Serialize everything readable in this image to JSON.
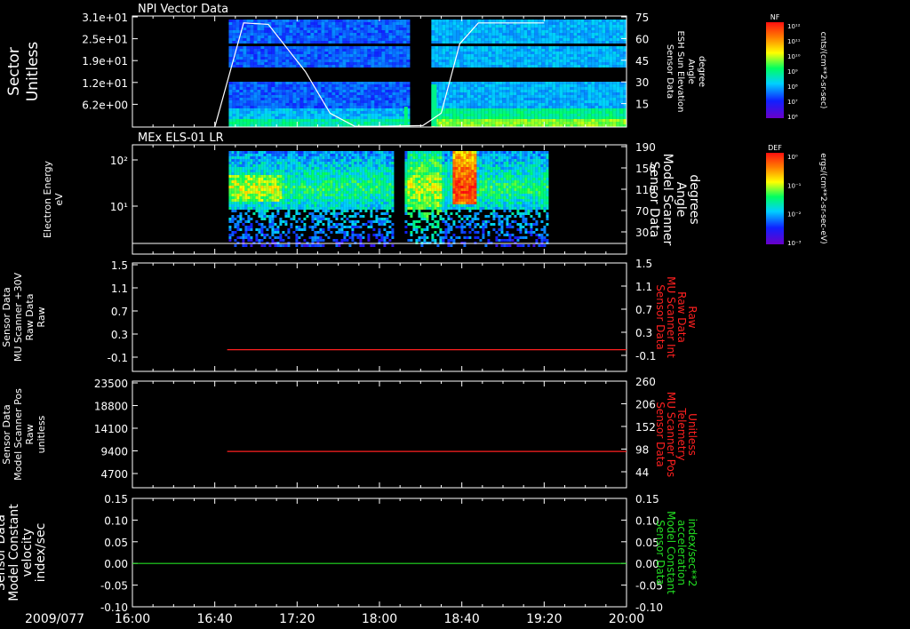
{
  "chart_data": {
    "date": "2009/077",
    "time_ticks": [
      "16:00",
      "16:40",
      "17:20",
      "18:00",
      "18:40",
      "19:20",
      "20:00"
    ],
    "panels": [
      {
        "type": "heatmap",
        "title": "NPI Vector Data",
        "ylabel": [
          "Sector",
          "Unitless"
        ],
        "yticks": [
          "3.1e+01",
          "2.5e+01",
          "1.9e+01",
          "1.2e+01",
          "6.2e+00"
        ],
        "right_ticks": [
          "75",
          "60",
          "45",
          "30",
          "15"
        ],
        "right_label": [
          "Sensor Data",
          "ESH Sun Elevation",
          "Angle",
          "degree"
        ],
        "right_label_color": "#ffffff",
        "overlay_line": {
          "name": "ESH Sun Elevation Angle",
          "points": [
            [
              16.667,
              0
            ],
            [
              16.9,
              75
            ],
            [
              17.1,
              74
            ],
            [
              17.4,
              40
            ],
            [
              17.6,
              10
            ],
            [
              17.8,
              0.5
            ],
            [
              18.0,
              0.5
            ],
            [
              18.35,
              1
            ],
            [
              18.5,
              10
            ],
            [
              18.65,
              60
            ],
            [
              18.8,
              75
            ],
            [
              19.333,
              75
            ]
          ],
          "color": "#ffffff"
        },
        "colorbar": {
          "label": "NF",
          "unit": "cnts/(cm**2-sr-sec)",
          "ticks": [
            "10¹²",
            "10¹¹",
            "10¹⁰",
            "10⁹",
            "10⁸",
            "10⁷",
            "10⁶"
          ]
        }
      },
      {
        "type": "heatmap",
        "title": "MEx ELS-01 LR",
        "ylabel": [
          "Electron Energy",
          "eV"
        ],
        "yticks": [
          "10²",
          "10¹"
        ],
        "right_ticks": [
          "190",
          "150",
          "110",
          "70",
          "30"
        ],
        "right_label": [
          "Sensor Data",
          "Model Scanner",
          "Angle",
          "degrees"
        ],
        "right_label_color": "#ffffff",
        "colorbar": {
          "label": "DEF",
          "unit": "ergs/(cm**2-sr-sec-eV)",
          "ticks": [
            "10⁰",
            "10⁻¹",
            "10⁻²",
            "10⁻³"
          ]
        }
      },
      {
        "type": "line",
        "ylabel": [
          "Sensor Data",
          "MU Scanner +30V",
          "Raw Data",
          "Raw"
        ],
        "yticks": [
          "1.5",
          "1.1",
          "0.7",
          "0.3",
          "-0.1"
        ],
        "right_ticks": [
          "1.5",
          "1.1",
          "0.7",
          "0.3",
          "-0.1"
        ],
        "right_label": [
          "Sensor Data",
          "MU Scanner Int",
          "Raw Data",
          "Raw"
        ],
        "right_label_color": "#ff2020",
        "ylim": [
          -0.5,
          1.5
        ],
        "series": [
          {
            "color": "#ff2020",
            "points": [
              [
                16.767,
                -0.1
              ],
              [
                20.0,
                -0.1
              ]
            ]
          }
        ]
      },
      {
        "type": "line",
        "ylabel": [
          "Sensor Data",
          "Model Scanner Pos",
          "Raw",
          "unitless"
        ],
        "yticks": [
          "23500",
          "18800",
          "14100",
          "9400",
          "4700"
        ],
        "right_ticks": [
          "260",
          "206",
          "152",
          "98",
          "44"
        ],
        "right_label": [
          "Sensor Data",
          "MU Scanner Pos",
          "Telemetry",
          "Unitless"
        ],
        "right_label_color": "#ff2020",
        "ylim": [
          0,
          23500
        ],
        "series": [
          {
            "color": "#ff2020",
            "points": [
              [
                16.767,
                8000
              ],
              [
                20.0,
                8000
              ]
            ]
          }
        ]
      },
      {
        "type": "line",
        "ylabel": [
          "Sensor Data",
          "Model Constant",
          "velocity",
          "index/sec"
        ],
        "yticks": [
          "0.15",
          "0.10",
          "0.05",
          "0.00",
          "-0.05",
          "-0.10"
        ],
        "right_ticks": [
          "0.15",
          "0.10",
          "0.05",
          "0.00",
          "-0.05",
          "-0.10"
        ],
        "right_label": [
          "Sensor Data",
          "Model Constant",
          "acceleration",
          "index/sec**2"
        ],
        "right_label_color": "#22dd22",
        "ylim": [
          -0.1,
          0.15
        ],
        "series": [
          {
            "color": "#22dd22",
            "points": [
              [
                16.0,
                0.0
              ],
              [
                20.0,
                0.0
              ]
            ]
          }
        ]
      }
    ]
  }
}
